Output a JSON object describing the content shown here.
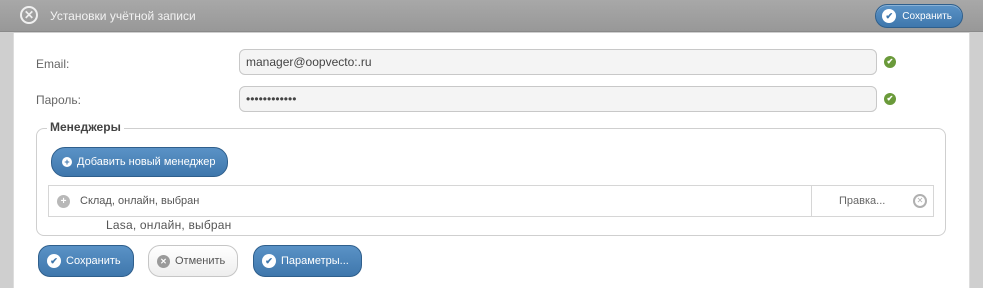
{
  "window": {
    "title": "Установки учётной записи",
    "top_save_label": "Сохранить"
  },
  "form": {
    "email_label": "Email:",
    "email_value": "manager@oopvecto:.ru",
    "password_label": "Пароль:",
    "password_value": "••••••••••••"
  },
  "managers": {
    "legend": "Менеджеры",
    "add_button": "Добавить новый менеджер",
    "rows": [
      {
        "text": "Склад, онлайн, выбран",
        "edit": "Правка..."
      }
    ],
    "ghost_text": "Lasa, онлайн, выбран"
  },
  "footer": {
    "save": "Сохранить",
    "cancel": "Отменить",
    "params": "Параметры..."
  },
  "colors": {
    "accent": "#3f77ac",
    "ok_green": "#6a9a3a",
    "titlebar": "#a0a0a0"
  },
  "icons": [
    "close-icon",
    "check-icon",
    "plus-icon",
    "expand-icon",
    "remove-icon",
    "ok-icon",
    "cancel-icon"
  ]
}
